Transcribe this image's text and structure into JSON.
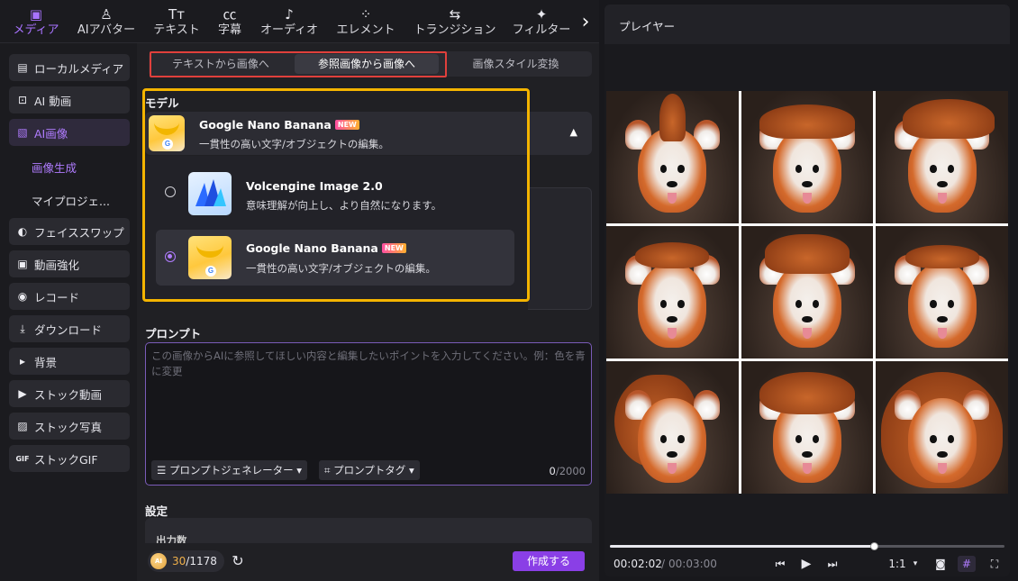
{
  "toolbar": {
    "tabs": [
      {
        "label": "メディア",
        "icon": "media-icon"
      },
      {
        "label": "AIアバター",
        "icon": "avatar-icon"
      },
      {
        "label": "テキスト",
        "icon": "text-icon"
      },
      {
        "label": "字幕",
        "icon": "caption-icon"
      },
      {
        "label": "オーディオ",
        "icon": "audio-icon"
      },
      {
        "label": "エレメント",
        "icon": "element-icon"
      },
      {
        "label": "トランジション",
        "icon": "transition-icon"
      },
      {
        "label": "フィルター",
        "icon": "filter-icon"
      }
    ],
    "active_tab": "メディア"
  },
  "sidebar": {
    "items": [
      {
        "label": "ローカルメディア",
        "icon": "folder-icon"
      },
      {
        "label": "AI 動画",
        "icon": "ai-video-icon"
      },
      {
        "label": "AI画像",
        "icon": "ai-image-icon"
      },
      {
        "label": "画像生成"
      },
      {
        "label": "マイプロジェ..."
      },
      {
        "label": "フェイススワップ",
        "icon": "face-swap-icon"
      },
      {
        "label": "動画強化",
        "icon": "enhance-icon"
      },
      {
        "label": "レコード",
        "icon": "record-icon"
      },
      {
        "label": "ダウンロード",
        "icon": "download-icon"
      },
      {
        "label": "背景",
        "icon": "triangle-icon"
      },
      {
        "label": "ストック動画",
        "icon": "stock-video-icon"
      },
      {
        "label": "ストック写真",
        "icon": "stock-photo-icon"
      },
      {
        "label": "ストックGIF",
        "icon": "gif-icon"
      }
    ]
  },
  "mode_tabs": [
    "テキストから画像へ",
    "参照画像から画像へ",
    "画像スタイル変換"
  ],
  "active_mode": "参照画像から画像へ",
  "model": {
    "section_title": "モデル",
    "selected": {
      "name": "Google Nano Banana",
      "badge": "NEW",
      "desc": "一貫性の高い文字/オブジェクトの編集。"
    },
    "options": [
      {
        "name": "Volcengine Image 2.0",
        "badge": "",
        "desc": "意味理解が向上し、より自然になります。",
        "selected": false
      },
      {
        "name": "Google Nano Banana",
        "badge": "NEW",
        "desc": "一貫性の高い文字/オブジェクトの編集。",
        "selected": true
      }
    ]
  },
  "prompt": {
    "section_title": "プロンプト",
    "placeholder": "この画像からAIに参照してほしい内容と編集したいポイントを入力してください。例：色を青に変更",
    "generator_label": "プロンプトジェネレーター",
    "tag_label": "プロンプトタグ",
    "count_current": "0",
    "count_max": "/2000"
  },
  "settings": {
    "section_title": "設定",
    "first_label": "出力数"
  },
  "footer": {
    "credit_coin": "AI",
    "credits_used": "30",
    "credits_total": "/1178",
    "create_label": "作成する"
  },
  "player": {
    "title": "プレイヤー",
    "time_current": "00:02:02",
    "time_sep": "/",
    "time_total": "00:03:00",
    "progress_fraction": 0.67,
    "ratio_label": "1:1"
  },
  "colors": {
    "accent": "#a873ff",
    "highlight_red": "#e0403c",
    "highlight_yellow": "#f4b400",
    "create_button": "#8a3fe6"
  }
}
